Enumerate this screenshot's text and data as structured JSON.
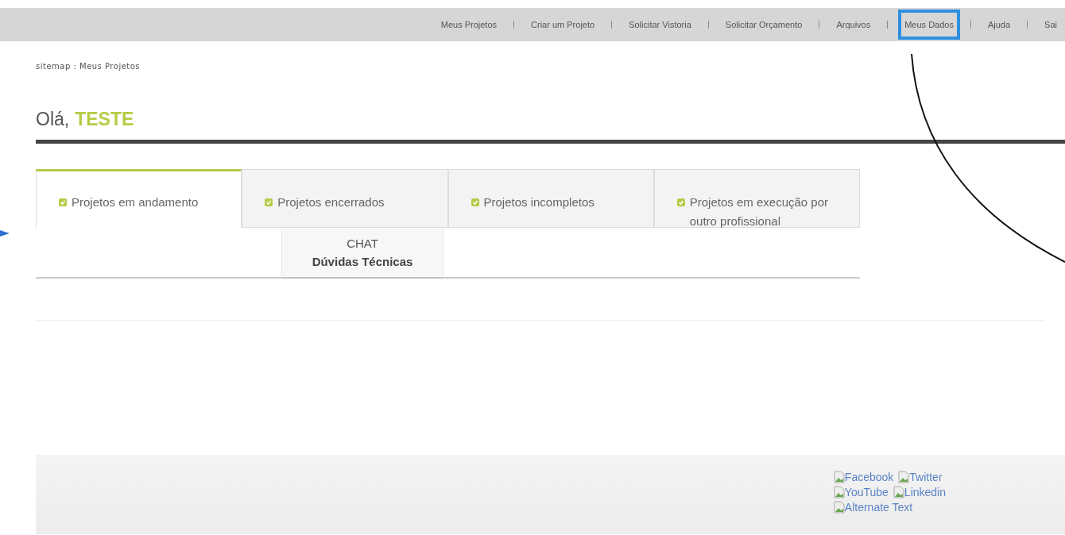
{
  "nav": [
    {
      "label": "Meus Projetos",
      "highlighted": false
    },
    {
      "label": "Criar um Projeto",
      "highlighted": false
    },
    {
      "label": "Solicitar Vistoria",
      "highlighted": false
    },
    {
      "label": "Solicitar Orçamento",
      "highlighted": false
    },
    {
      "label": "Arquivos",
      "highlighted": false
    },
    {
      "label": "Meus Dados",
      "highlighted": true
    },
    {
      "label": "Ajuda",
      "highlighted": false
    },
    {
      "label": "Sai",
      "highlighted": false
    }
  ],
  "breadcrumb": "sitemap : Meus Projetos",
  "greeting": {
    "prefix": "Olá,",
    "name": "TESTE"
  },
  "tabs": [
    {
      "label": "Projetos em andamento",
      "selected": true
    },
    {
      "label": "Projetos encerrados",
      "selected": false
    },
    {
      "label": "Projetos incompletos",
      "selected": false
    },
    {
      "label": "Projetos em execução por outro profissional",
      "selected": false
    }
  ],
  "chat": {
    "title": "CHAT",
    "subtitle": "Dúvidas Técnicas"
  },
  "footer_links": [
    [
      "Facebook",
      "Twitter"
    ],
    [
      "YouTube",
      "Linkedin"
    ],
    [
      "Alternate Text"
    ]
  ]
}
